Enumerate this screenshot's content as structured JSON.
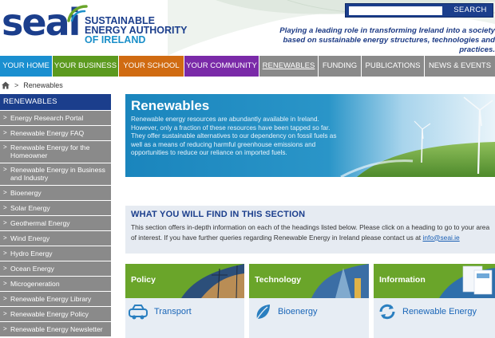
{
  "header": {
    "logo": {
      "word": "seai",
      "line1": "SUSTAINABLE",
      "line2": "ENERGY AUTHORITY",
      "line3": "OF IRELAND"
    },
    "tagline_line1": "Playing a leading role in transforming Ireland into a society",
    "tagline_line2": "based on sustainable energy structures, technologies and practices.",
    "search": {
      "placeholder": "",
      "button_label": "SEARCH"
    }
  },
  "nav": {
    "tabs": [
      {
        "label": "YOUR HOME",
        "color": "#1a8fd0"
      },
      {
        "label": "YOUR BUSINESS",
        "color": "#5c9a1f"
      },
      {
        "label": "YOUR SCHOOL",
        "color": "#d06b12"
      },
      {
        "label": "YOUR COMMUNITY",
        "color": "#7a2aa8"
      },
      {
        "label": "RENEWABLES",
        "color": "#8a8a8a"
      },
      {
        "label": "FUNDING",
        "color": "#8a8a8a"
      },
      {
        "label": "PUBLICATIONS",
        "color": "#8a8a8a"
      },
      {
        "label": "NEWS & EVENTS",
        "color": "#8a8a8a"
      }
    ]
  },
  "breadcrumb": {
    "separator": ">",
    "current": "Renewables",
    "home_icon": "home-icon"
  },
  "sidebar": {
    "heading": "RENEWABLES",
    "items": [
      {
        "label": "Energy Research Portal"
      },
      {
        "label": "Renewable Energy FAQ"
      },
      {
        "label_line1": "Renewable Energy for the",
        "label_line2": "Homeowner"
      },
      {
        "label_line1": "Renewable Energy in Business",
        "label_line2": "and Industry"
      },
      {
        "label": "Bioenergy"
      },
      {
        "label": "Solar Energy"
      },
      {
        "label": "Geothermal Energy"
      },
      {
        "label": "Wind Energy"
      },
      {
        "label": "Hydro Energy"
      },
      {
        "label": "Ocean Energy"
      },
      {
        "label": "Microgeneration"
      },
      {
        "label": "Renewable Energy Library"
      },
      {
        "label": "Renewable Energy Policy"
      },
      {
        "label": "Renewable Energy Newsletter"
      }
    ]
  },
  "hero": {
    "title": "Renewables",
    "text": "Renewable energy resources are abundantly available in Ireland. However, only a fraction of these resources have been tapped so far. They offer sustainable alternatives to our dependency on fossil fuels as well as a means of reducing harmful greenhouse emissions and opportunities to reduce our reliance on imported fuels."
  },
  "section": {
    "title": "WHAT YOU WILL FIND IN THIS SECTION",
    "text": "This section offers in-depth information on each of the headings listed below. Please click on a heading to go to your area of interest. If you have further queries regarding Renewable Energy in Ireland please contact us at ",
    "link": "info@seai.ie"
  },
  "cards": [
    {
      "title": "Policy",
      "link": "Transport",
      "icon": "car-icon"
    },
    {
      "title": "Technology",
      "link": "Bioenergy",
      "icon": "leaf-icon"
    },
    {
      "title": "Information",
      "link": "Renewable Energy",
      "icon": "recycle-icon"
    }
  ],
  "colors": {
    "brand_blue": "#1b3e8c",
    "accent_green": "#6aa52a",
    "sidebar_grey": "#8a8a8a",
    "link_blue": "#1a66b8"
  }
}
